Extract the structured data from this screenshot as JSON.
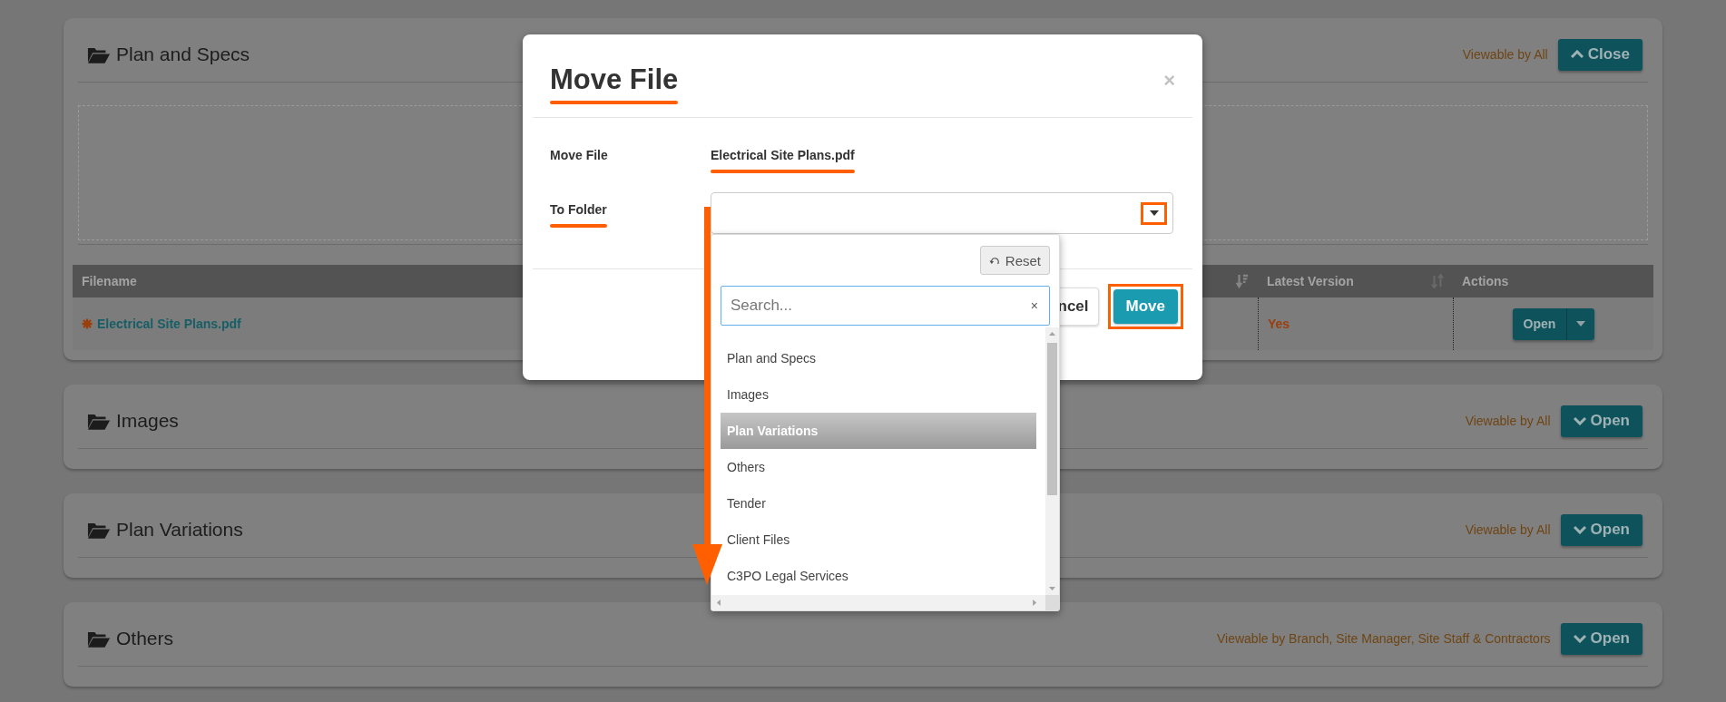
{
  "sections": [
    {
      "title": "Plan and Specs",
      "visibility": "Viewable by All",
      "toggle": {
        "label": "Close",
        "expanded": true
      },
      "table": {
        "columns": [
          {
            "label": "Filename"
          },
          {
            "sortable": true,
            "sorted": true
          },
          {
            "label": "Latest Version",
            "sortable": true,
            "sorted": false
          },
          {
            "label": "Actions"
          }
        ],
        "rows": [
          {
            "filename": "Electrical Site Plans.pdf",
            "new": true,
            "latest": "Yes",
            "action": "Open"
          }
        ]
      }
    },
    {
      "title": "Images",
      "visibility": "Viewable by All",
      "toggle": {
        "label": "Open",
        "expanded": false
      }
    },
    {
      "title": "Plan Variations",
      "visibility": "Viewable by All",
      "toggle": {
        "label": "Open",
        "expanded": false
      }
    },
    {
      "title": "Others",
      "visibility": "Viewable by Branch, Site Manager, Site Staff & Contractors",
      "toggle": {
        "label": "Open",
        "expanded": false
      }
    }
  ],
  "modal": {
    "title": "Move File",
    "title_underlined": true,
    "close": "×",
    "fields": [
      {
        "label": "Move File",
        "value": "Electrical Site Plans.pdf",
        "value_underlined": true
      },
      {
        "label": "To Folder",
        "label_underlined": true,
        "kind": "select",
        "caret_boxed": true
      }
    ],
    "buttons": [
      {
        "label": "ncel",
        "kind": "default",
        "boxed": false
      },
      {
        "label": "Move",
        "kind": "primary",
        "boxed": true
      }
    ],
    "dropdown": {
      "reset": "Reset",
      "placeholder": "Search...",
      "clear": "×",
      "options": [
        {
          "label": "Plan and Specs",
          "selected": false
        },
        {
          "label": "Images",
          "selected": false
        },
        {
          "label": "Plan Variations",
          "selected": true
        },
        {
          "label": "Others",
          "selected": false
        },
        {
          "label": "Tender",
          "selected": false
        },
        {
          "label": "Client Files",
          "selected": false
        },
        {
          "label": "C3PO Legal Services",
          "selected": false
        }
      ]
    }
  }
}
